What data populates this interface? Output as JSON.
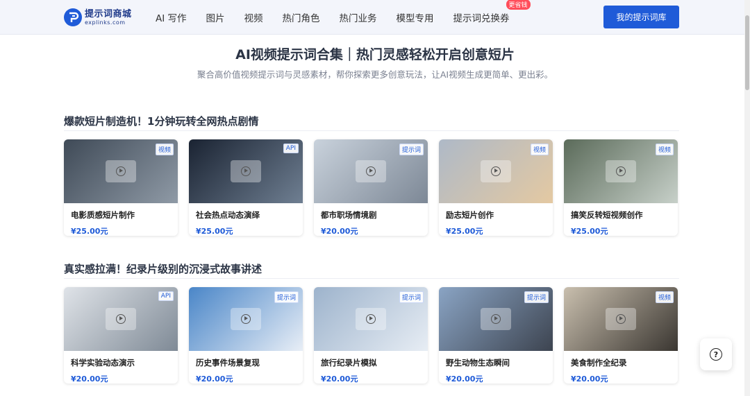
{
  "header": {
    "logo_cn": "提示词商城",
    "logo_en": "explinks.com",
    "nav": [
      {
        "label": "AI 写作"
      },
      {
        "label": "图片"
      },
      {
        "label": "视频"
      },
      {
        "label": "热门角色"
      },
      {
        "label": "热门业务"
      },
      {
        "label": "模型专用"
      },
      {
        "label": "提示词兑换券",
        "badge": "更省钱"
      }
    ],
    "cta_label": "我的提示词库"
  },
  "hero": {
    "title": "AI视频提示词合集｜热门灵感轻松开启创意短片",
    "subtitle": "聚合高价值视频提示词与灵感素材，帮你探索更多创意玩法，让AI视频生成更简单、更出彩。"
  },
  "sections": [
    {
      "title": "爆款短片制造机！1分钟玩转全网热点剧情",
      "cards": [
        {
          "title": "电影质感短片制作",
          "price": "¥25.00元",
          "tag": "视频",
          "bg": "#3f4a57",
          "bg2": "#8f9aa6"
        },
        {
          "title": "社会热点动态演绎",
          "price": "¥25.00元",
          "tag": "API",
          "bg": "#1a2332",
          "bg2": "#6f7f92"
        },
        {
          "title": "都市职场情境剧",
          "price": "¥20.00元",
          "tag": "提示词",
          "bg": "#c9d2dc",
          "bg2": "#7d8896"
        },
        {
          "title": "励志短片创作",
          "price": "¥25.00元",
          "tag": "视频",
          "bg": "#aeb9c7",
          "bg2": "#e4c9a2"
        },
        {
          "title": "搞笑反转短视频创作",
          "price": "¥25.00元",
          "tag": "视频",
          "bg": "#5b6b5a",
          "bg2": "#c7d0c9"
        }
      ]
    },
    {
      "title": "真实感拉满！纪录片级别的沉浸式故事讲述",
      "cards": [
        {
          "title": "科学实验动态演示",
          "price": "¥20.00元",
          "tag": "API",
          "bg": "#dfe3e8",
          "bg2": "#7f8a96"
        },
        {
          "title": "历史事件场景复现",
          "price": "¥20.00元",
          "tag": "提示词",
          "bg": "#4a86c8",
          "bg2": "#e8eef6"
        },
        {
          "title": "旅行纪录片模拟",
          "price": "¥20.00元",
          "tag": "提示词",
          "bg": "#9db3cc",
          "bg2": "#e7edf4"
        },
        {
          "title": "野生动物生态瞬间",
          "price": "¥20.00元",
          "tag": "提示词",
          "bg": "#8aa4c4",
          "bg2": "#3d4450"
        },
        {
          "title": "美食制作全纪录",
          "price": "¥20.00元",
          "tag": "视频",
          "bg": "#c9bfae",
          "bg2": "#3a3631"
        }
      ]
    }
  ],
  "help_label": "?",
  "colors": {
    "accent": "#1f5bd8",
    "badge": "#ff4d5a",
    "header_bg": "#f3f5fb"
  }
}
